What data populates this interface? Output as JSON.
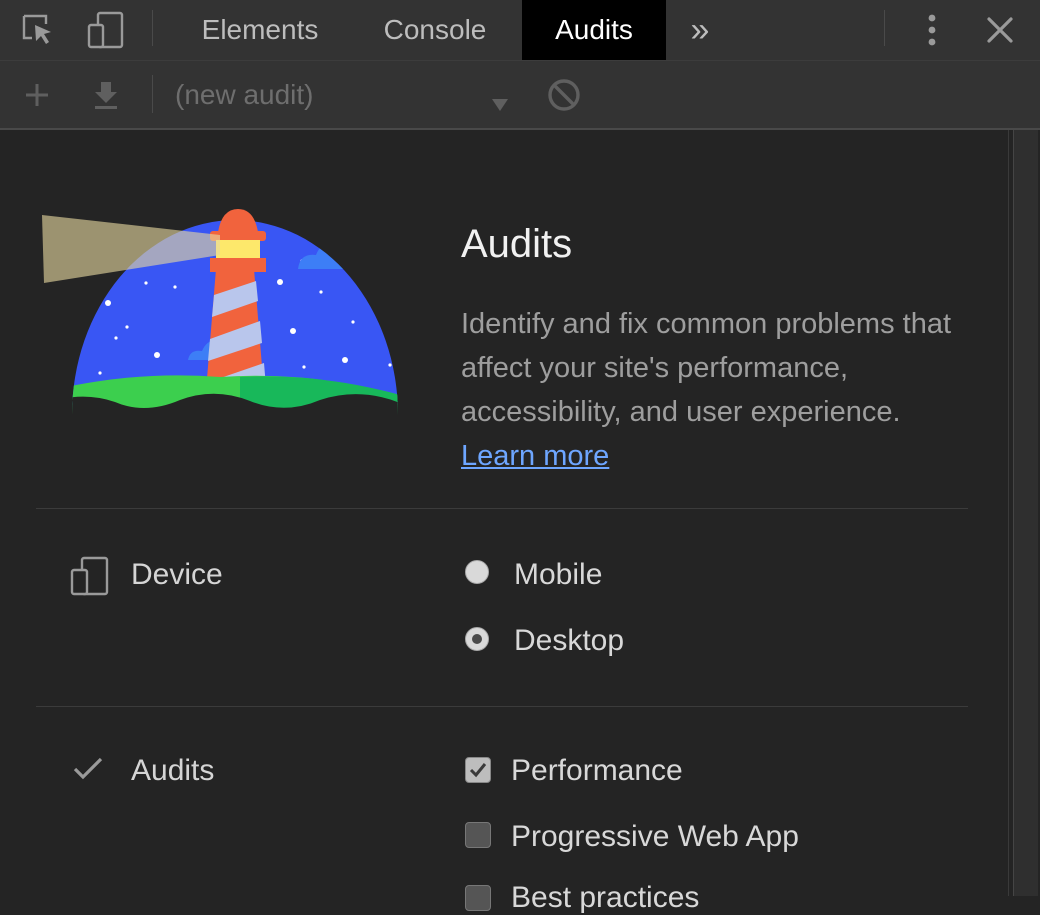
{
  "tabbar": {
    "tabs": [
      {
        "label": "Elements",
        "active": false
      },
      {
        "label": "Console",
        "active": false
      },
      {
        "label": "Audits",
        "active": true
      }
    ],
    "overflow_label": "»"
  },
  "toolbar": {
    "audit_select_value": "(new audit)"
  },
  "header": {
    "title": "Audits",
    "description": "Identify and fix common problems that affect your site's performance, accessibility, and user experience.",
    "learn_more": "Learn more"
  },
  "device": {
    "label": "Device",
    "options": [
      {
        "label": "Mobile",
        "selected": false
      },
      {
        "label": "Desktop",
        "selected": true
      }
    ]
  },
  "audits": {
    "label": "Audits",
    "categories": [
      {
        "label": "Performance",
        "checked": true
      },
      {
        "label": "Progressive Web App",
        "checked": false
      },
      {
        "label": "Best practices",
        "checked": false
      }
    ]
  },
  "colors": {
    "accent_link": "#6ea6ff",
    "active_tab_bg": "#000000",
    "panel_bg": "#242424"
  }
}
